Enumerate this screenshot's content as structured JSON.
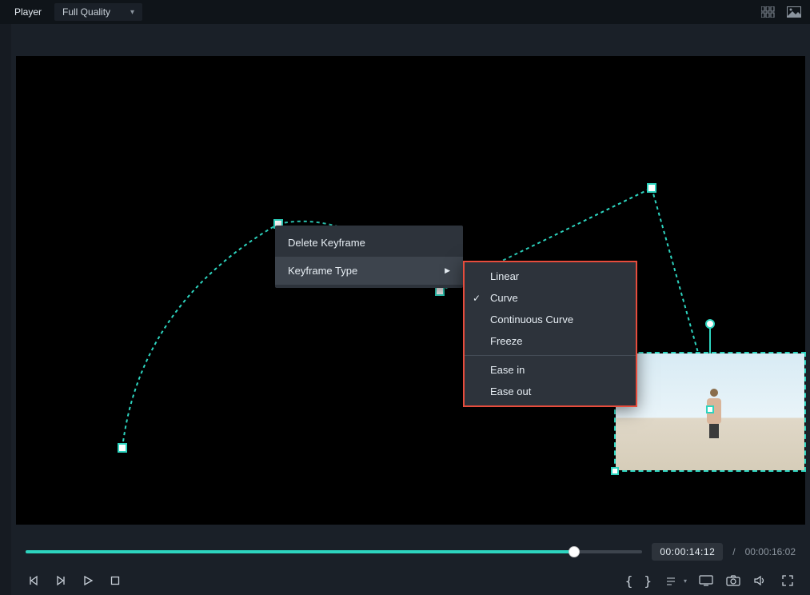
{
  "topbar": {
    "player_label": "Player",
    "quality_value": "Full Quality"
  },
  "context_menu": {
    "delete": "Delete Keyframe",
    "type": "Keyframe Type"
  },
  "keyframe_types": {
    "linear": "Linear",
    "curve": "Curve",
    "continuous": "Continuous Curve",
    "freeze": "Freeze",
    "ease_in": "Ease in",
    "ease_out": "Ease out",
    "selected": "curve"
  },
  "transport": {
    "current_time": "00:00:14:12",
    "total_time": "00:00:16:02",
    "progress_pct": 89
  }
}
